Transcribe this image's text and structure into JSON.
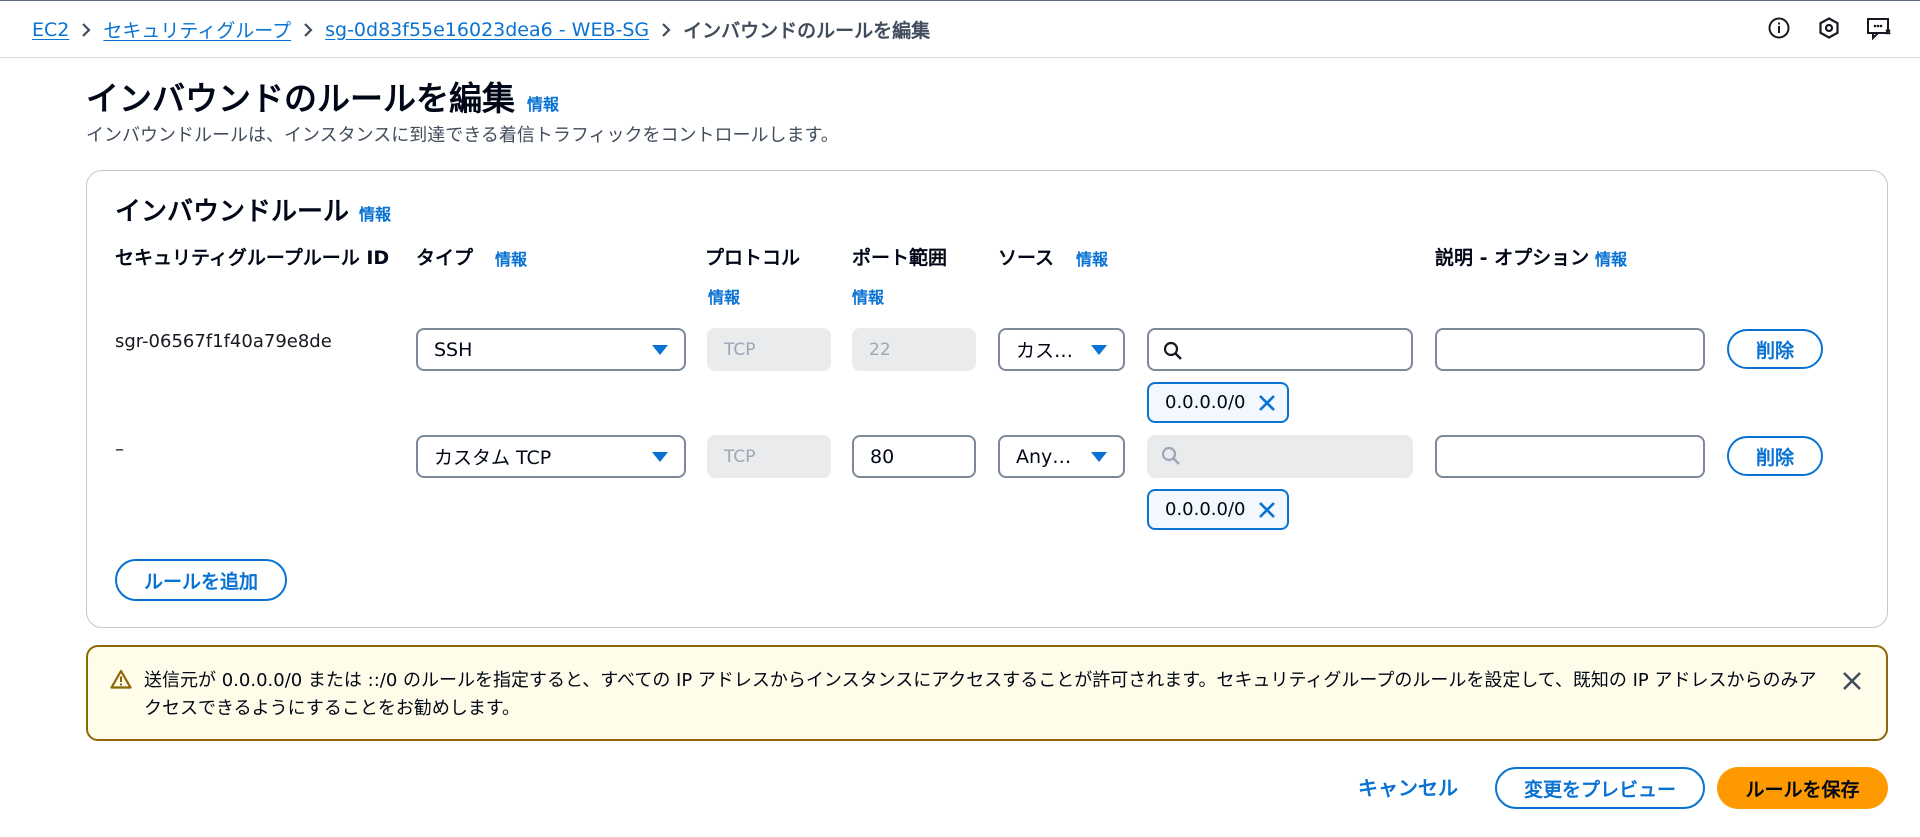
{
  "breadcrumb": {
    "items": [
      "EC2",
      "セキュリティグループ",
      "sg-0d83f55e16023dea6 - WEB-SG"
    ],
    "current": "インバウンドのルールを編集"
  },
  "header": {
    "title": "インバウンドのルールを編集",
    "info": "情報",
    "description": "インバウンドルールは、インスタンスに到達できる着信トラフィックをコントロールします。"
  },
  "panel": {
    "title": "インバウンドルール",
    "info": "情報",
    "columns": {
      "rule_id": "セキュリティグループルール ID",
      "type": "タイプ",
      "protocol": "プロトコル",
      "port_range": "ポート範囲",
      "source": "ソース",
      "description": "説明 - オプション"
    },
    "rules": [
      {
        "rule_id": "sgr-06567f1f40a79e8de",
        "type": "SSH",
        "protocol": "TCP",
        "port_range": "22",
        "source_type": "カス…",
        "source_search": "",
        "source_token": "0.0.0.0/0",
        "description": "",
        "delete_label": "削除"
      },
      {
        "rule_id": "–",
        "type": "カスタム TCP",
        "protocol": "TCP",
        "port_range": "80",
        "source_type": "Any…",
        "source_search": "",
        "source_token": "0.0.0.0/0",
        "description": "",
        "delete_label": "削除"
      }
    ],
    "add_rule_label": "ルールを追加"
  },
  "warning": {
    "text": "送信元が 0.0.0.0/0 または ::/0 のルールを指定すると、すべての IP アドレスからインスタンスにアクセスすることが許可されます。セキュリティグループのルールを設定して、既知の IP アドレスからのみアクセスできるようにすることをお勧めします。"
  },
  "footer": {
    "cancel": "キャンセル",
    "preview": "変更をプレビュー",
    "save": "ルールを保存"
  },
  "colors": {
    "link": "#0972d3",
    "primary_button": "#ff9900",
    "warning_border": "#8d6605",
    "warning_bg": "#fffce9"
  },
  "icons": [
    "chevron-right-icon",
    "info-circle-icon",
    "settings-hexagon-icon",
    "feedback-icon",
    "dropdown-caret-icon",
    "search-icon",
    "dismiss-icon",
    "warning-icon",
    "close-icon"
  ]
}
